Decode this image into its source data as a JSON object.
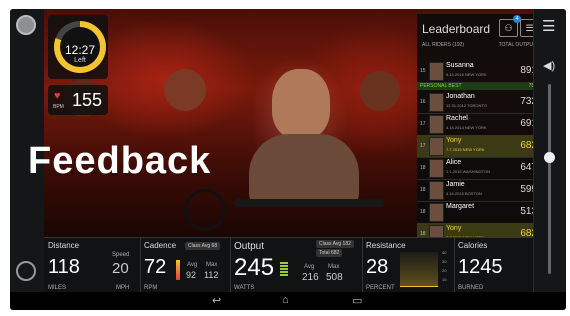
{
  "timer": {
    "time": "12:27",
    "label": "Left",
    "progress": 0.8
  },
  "heart_rate": {
    "label": "BPM",
    "value": "155"
  },
  "overlay": {
    "feedback": "Feedback"
  },
  "leaderboard": {
    "title": "Leaderboard",
    "badge": "4",
    "header_left": "ALL RIDERS (192)",
    "header_right": "TOTAL OUTPUT",
    "personal_best": {
      "label": "PERSONAL BEST",
      "value": "780"
    },
    "rows": [
      {
        "rank": "15",
        "name": "Susanna",
        "sub": "5.14.2015   NEW YORK",
        "score": "891",
        "highlight": false
      },
      {
        "rank": "16",
        "name": "Jonathan",
        "sub": "12.31.2012   TORONTO",
        "score": "732",
        "highlight": false
      },
      {
        "rank": "17",
        "name": "Rachel",
        "sub": "4.14.2014   NEW YORK",
        "score": "691",
        "highlight": false
      },
      {
        "rank": "17",
        "name": "Yony",
        "sub": "7.7.2015   NEW YORK",
        "score": "682",
        "highlight": true
      },
      {
        "rank": "18",
        "name": "Alice",
        "sub": "1.1.2015   WASHINGTON",
        "score": "647",
        "highlight": false
      },
      {
        "rank": "18",
        "name": "Jamie",
        "sub": "4.14.2015   BOSTON",
        "score": "599",
        "highlight": false
      },
      {
        "rank": "18",
        "name": "Margaret",
        "sub": "",
        "score": "513",
        "highlight": false
      },
      {
        "rank": "18",
        "name": "Yony",
        "sub": "7.7.2015   NEW YORK",
        "score": "682",
        "highlight": true
      }
    ]
  },
  "metrics": {
    "distance": {
      "title": "Distance",
      "value": "118",
      "unit": "MILES",
      "speed_label": "Speed",
      "speed_value": "20",
      "speed_unit": "MPH"
    },
    "cadence": {
      "title": "Cadence",
      "value": "72",
      "unit": "RPM",
      "class_avg": "Class Avg",
      "class_avg_value": "68",
      "avg_label": "Avg",
      "avg_value": "92",
      "max_label": "Max",
      "max_value": "112"
    },
    "output": {
      "title": "Output",
      "value": "245",
      "unit": "WATTS",
      "class_avg": "Class Avg",
      "class_avg_value": "182",
      "total_label": "Total",
      "total_value": "682",
      "avg_label": "Avg",
      "avg_value": "216",
      "max_label": "Max",
      "max_value": "508"
    },
    "resistance": {
      "title": "Resistance",
      "value": "28",
      "unit": "PERCENT",
      "scale": [
        "40",
        "30",
        "20",
        "10"
      ]
    },
    "calories": {
      "title": "Calories",
      "value": "1245",
      "unit": "BURNED"
    }
  },
  "icons": {
    "settings": "gear-icon",
    "menu": "menu-icon",
    "volume": "speaker-icon",
    "peloton": "logo-icon"
  },
  "colors": {
    "accent": "#f4c430",
    "personal_best": "#7cd93c",
    "heart": "#e53935"
  }
}
